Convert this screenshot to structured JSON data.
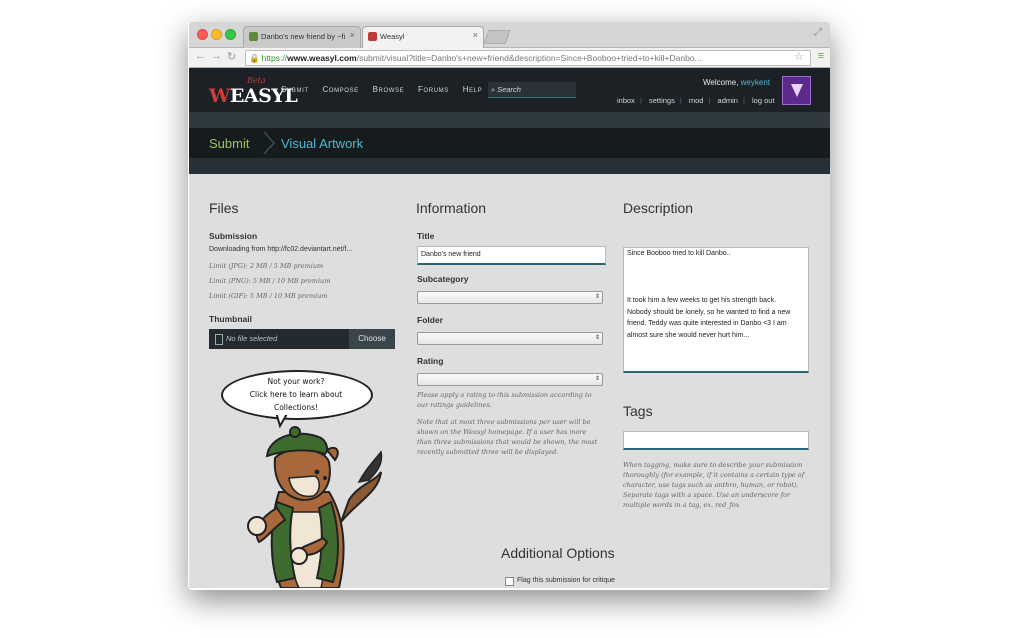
{
  "browser": {
    "tabs": [
      {
        "title": "Danbo's new friend by ~fi",
        "close": "×"
      },
      {
        "title": "Weasyl",
        "close": "×"
      }
    ],
    "url": {
      "scheme": "https://",
      "domain": "www.weasyl.com",
      "path": "/submit/visual?title=Danbo's+new+friend&description=Since+Booboo+tried+to+kill+Danbo..."
    }
  },
  "site": {
    "logo_beta": "Beta",
    "logo_text_w": "W",
    "logo_text_rest": "EASYL",
    "nav": [
      "Submit",
      "Compose",
      "Browse",
      "Forums",
      "Help"
    ],
    "search_placeholder": "Search",
    "welcome_prefix": "Welcome,",
    "username": "weykent",
    "user_links": [
      "inbox",
      "settings",
      "mod",
      "admin",
      "log out"
    ],
    "accent_color": "#4fb8d0",
    "brand_color": "#d23b3b"
  },
  "breadcrumb": {
    "first": "Submit",
    "second": "Visual Artwork"
  },
  "files": {
    "heading": "Files",
    "submission_label": "Submission",
    "downloading": "Downloading from http://fc02.deviantart.net/f...",
    "limits": [
      "Limit (JPG): 2 MB / 5 MB premium",
      "Limit (PNG): 5 MB / 10 MB premium",
      "Limit (GIF): 5 MB / 10 MB premium"
    ],
    "thumbnail_label": "Thumbnail",
    "no_file": "No file selected",
    "choose": "Choose",
    "bubble_line1": "Not your work?",
    "bubble_line2": "Click here to learn about Collections!"
  },
  "information": {
    "heading": "Information",
    "title_label": "Title",
    "title_value": "Danbo's new friend",
    "subcategory_label": "Subcategory",
    "folder_label": "Folder",
    "rating_label": "Rating",
    "rating_note": "Please apply a rating to this submission according to our ratings guidelines.",
    "limit_note": "Note that at most three submissions per user will be shown on the Weasyl homepage. If a user has more than three submissions that would be shown, the most recently submitted three will be displayed."
  },
  "description": {
    "heading": "Description",
    "lines": [
      "Since Booboo tried to kill Danbo..",
      "",
      "",
      "",
      "It took him a few weeks to get his strength back.",
      "Nobody should be lonely, so he wanted to find a new friend. Teddy was quite interested in Danbo <3 I am almost sure she would never hurt him..."
    ]
  },
  "tags": {
    "heading": "Tags",
    "help": "When tagging, make sure to describe your submission thoroughly (for example, if it contains a certain type of character, use tags such as anthro, human, or robot). Separate tags with a space. Use an underscore for multiple words in a tag, ex. red_fox"
  },
  "additional": {
    "heading": "Additional Options",
    "critique_label": "Flag this submission for critique"
  }
}
